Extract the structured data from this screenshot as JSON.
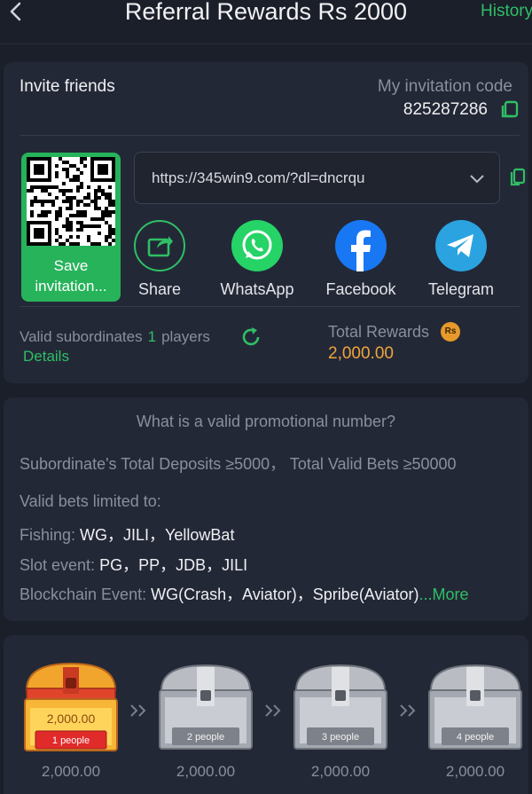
{
  "header": {
    "title": "Referral Rewards Rs 2000",
    "history_label": "History"
  },
  "invite": {
    "label": "Invite friends",
    "code_label": "My invitation code",
    "code": "825287286",
    "qr_label": "Save invitation...",
    "url": "https://345win9.com/?dl=dncrqu"
  },
  "share": [
    {
      "label": "Share",
      "icon": "share-icon",
      "color": "#232837"
    },
    {
      "label": "WhatsApp",
      "icon": "whatsapp-icon",
      "color": "#25d366"
    },
    {
      "label": "Facebook",
      "icon": "facebook-icon",
      "color": "#1877f2"
    },
    {
      "label": "Telegram",
      "icon": "telegram-icon",
      "color": "#2aa3e0"
    }
  ],
  "stats": {
    "valid_subordinates_label": "Valid subordinates",
    "valid_subordinates_count": "1",
    "players_label": "players",
    "details_label": "Details",
    "total_rewards_label": "Total Rewards",
    "rs_badge": "Rs",
    "total_rewards_value": "2,000.00"
  },
  "promo": {
    "question": "What is a valid promotional number?",
    "requirement": "Subordinate's Total Deposits ≥5000， Total Valid Bets ≥50000",
    "limited_label": "Valid bets limited to:",
    "fishing_label": "Fishing:",
    "fishing_value": "WG，JILI，YellowBat",
    "slot_label": "Slot event:",
    "slot_value": "PG，PP，JDB，JILI",
    "blockchain_label": "Blockchain Event:",
    "blockchain_value": "WG(Crash，Aviator)，Spribe(Aviator)",
    "more_label": "...More"
  },
  "rewards": [
    {
      "people": "1 people",
      "amount": "2,000.00",
      "chest_amount": "2,000.00",
      "status": "claimed"
    },
    {
      "people": "2 people",
      "amount": "2,000.00",
      "status": "locked"
    },
    {
      "people": "3 people",
      "amount": "2,000.00",
      "status": "locked"
    },
    {
      "people": "4 people",
      "amount": "2,000.00",
      "status": "locked"
    }
  ],
  "colors": {
    "accent": "#2fbf65",
    "gold": "#f0a53a",
    "background": "#1b1f2a",
    "card": "#232837"
  }
}
